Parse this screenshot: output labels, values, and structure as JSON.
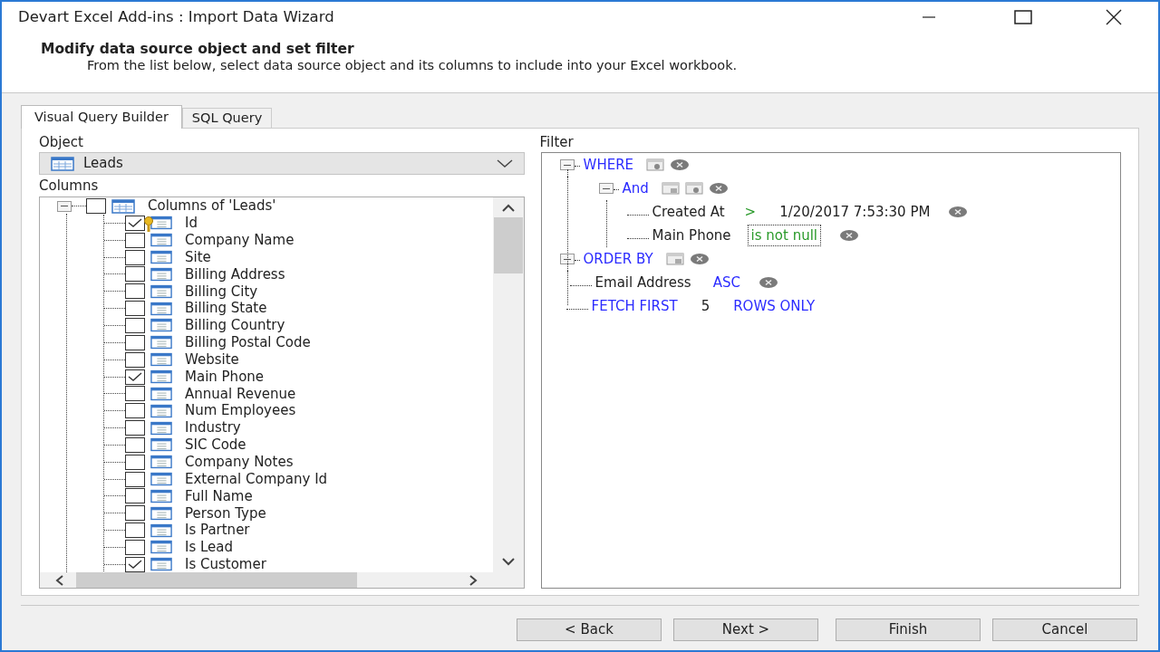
{
  "window": {
    "title": "Devart Excel Add-ins : Import Data Wizard"
  },
  "header": {
    "title": "Modify data source object and set filter",
    "description": "From the list below, select data source object and its columns to include into your Excel workbook."
  },
  "tabs": [
    {
      "label": "Visual Query Builder",
      "selected": true
    },
    {
      "label": "SQL Query",
      "selected": false
    }
  ],
  "object": {
    "label": "Object",
    "value": "Leads"
  },
  "columns": {
    "label": "Columns",
    "root": {
      "label": "Columns of 'Leads'",
      "checked": false,
      "expanded": true,
      "children": [
        {
          "label": "Id",
          "checked": true,
          "key": true
        },
        {
          "label": "Company Name",
          "checked": false,
          "key": false
        },
        {
          "label": "Site",
          "checked": false,
          "key": false
        },
        {
          "label": "Billing Address",
          "checked": false,
          "key": false
        },
        {
          "label": "Billing City",
          "checked": false,
          "key": false
        },
        {
          "label": "Billing State",
          "checked": false,
          "key": false
        },
        {
          "label": "Billing Country",
          "checked": false,
          "key": false
        },
        {
          "label": "Billing Postal Code",
          "checked": false,
          "key": false
        },
        {
          "label": "Website",
          "checked": false,
          "key": false
        },
        {
          "label": "Main Phone",
          "checked": true,
          "key": false
        },
        {
          "label": "Annual Revenue",
          "checked": false,
          "key": false
        },
        {
          "label": "Num Employees",
          "checked": false,
          "key": false
        },
        {
          "label": "Industry",
          "checked": false,
          "key": false
        },
        {
          "label": "SIC Code",
          "checked": false,
          "key": false
        },
        {
          "label": "Company Notes",
          "checked": false,
          "key": false
        },
        {
          "label": "External Company Id",
          "checked": false,
          "key": false
        },
        {
          "label": "Full Name",
          "checked": false,
          "key": false
        },
        {
          "label": "Person Type",
          "checked": false,
          "key": false
        },
        {
          "label": "Is Partner",
          "checked": false,
          "key": false
        },
        {
          "label": "Is Lead",
          "checked": false,
          "key": false
        },
        {
          "label": "Is Customer",
          "checked": true,
          "key": false
        }
      ]
    }
  },
  "filter": {
    "label": "Filter",
    "nodes": [
      {
        "kind": "where",
        "keyword": "WHERE",
        "expanded": true,
        "children": [
          {
            "kind": "group",
            "keyword": "And",
            "expanded": true,
            "children": [
              {
                "kind": "condition",
                "field": "Created At",
                "operator": ">",
                "value": "1/20/2017 7:53:30 PM",
                "focused": false
              },
              {
                "kind": "condition",
                "field": "Main Phone",
                "operator": "is not null",
                "focused": true
              }
            ]
          }
        ]
      },
      {
        "kind": "order",
        "keyword": "ORDER BY",
        "expanded": true,
        "children": [
          {
            "kind": "sort",
            "field": "Email Address",
            "direction": "ASC"
          }
        ]
      },
      {
        "kind": "fetch",
        "keyword": "FETCH FIRST",
        "count": "5",
        "suffix": "ROWS ONLY"
      }
    ]
  },
  "buttons": [
    {
      "label": "< Back"
    },
    {
      "label": "Next >"
    },
    {
      "label": "Finish"
    },
    {
      "label": "Cancel"
    }
  ]
}
